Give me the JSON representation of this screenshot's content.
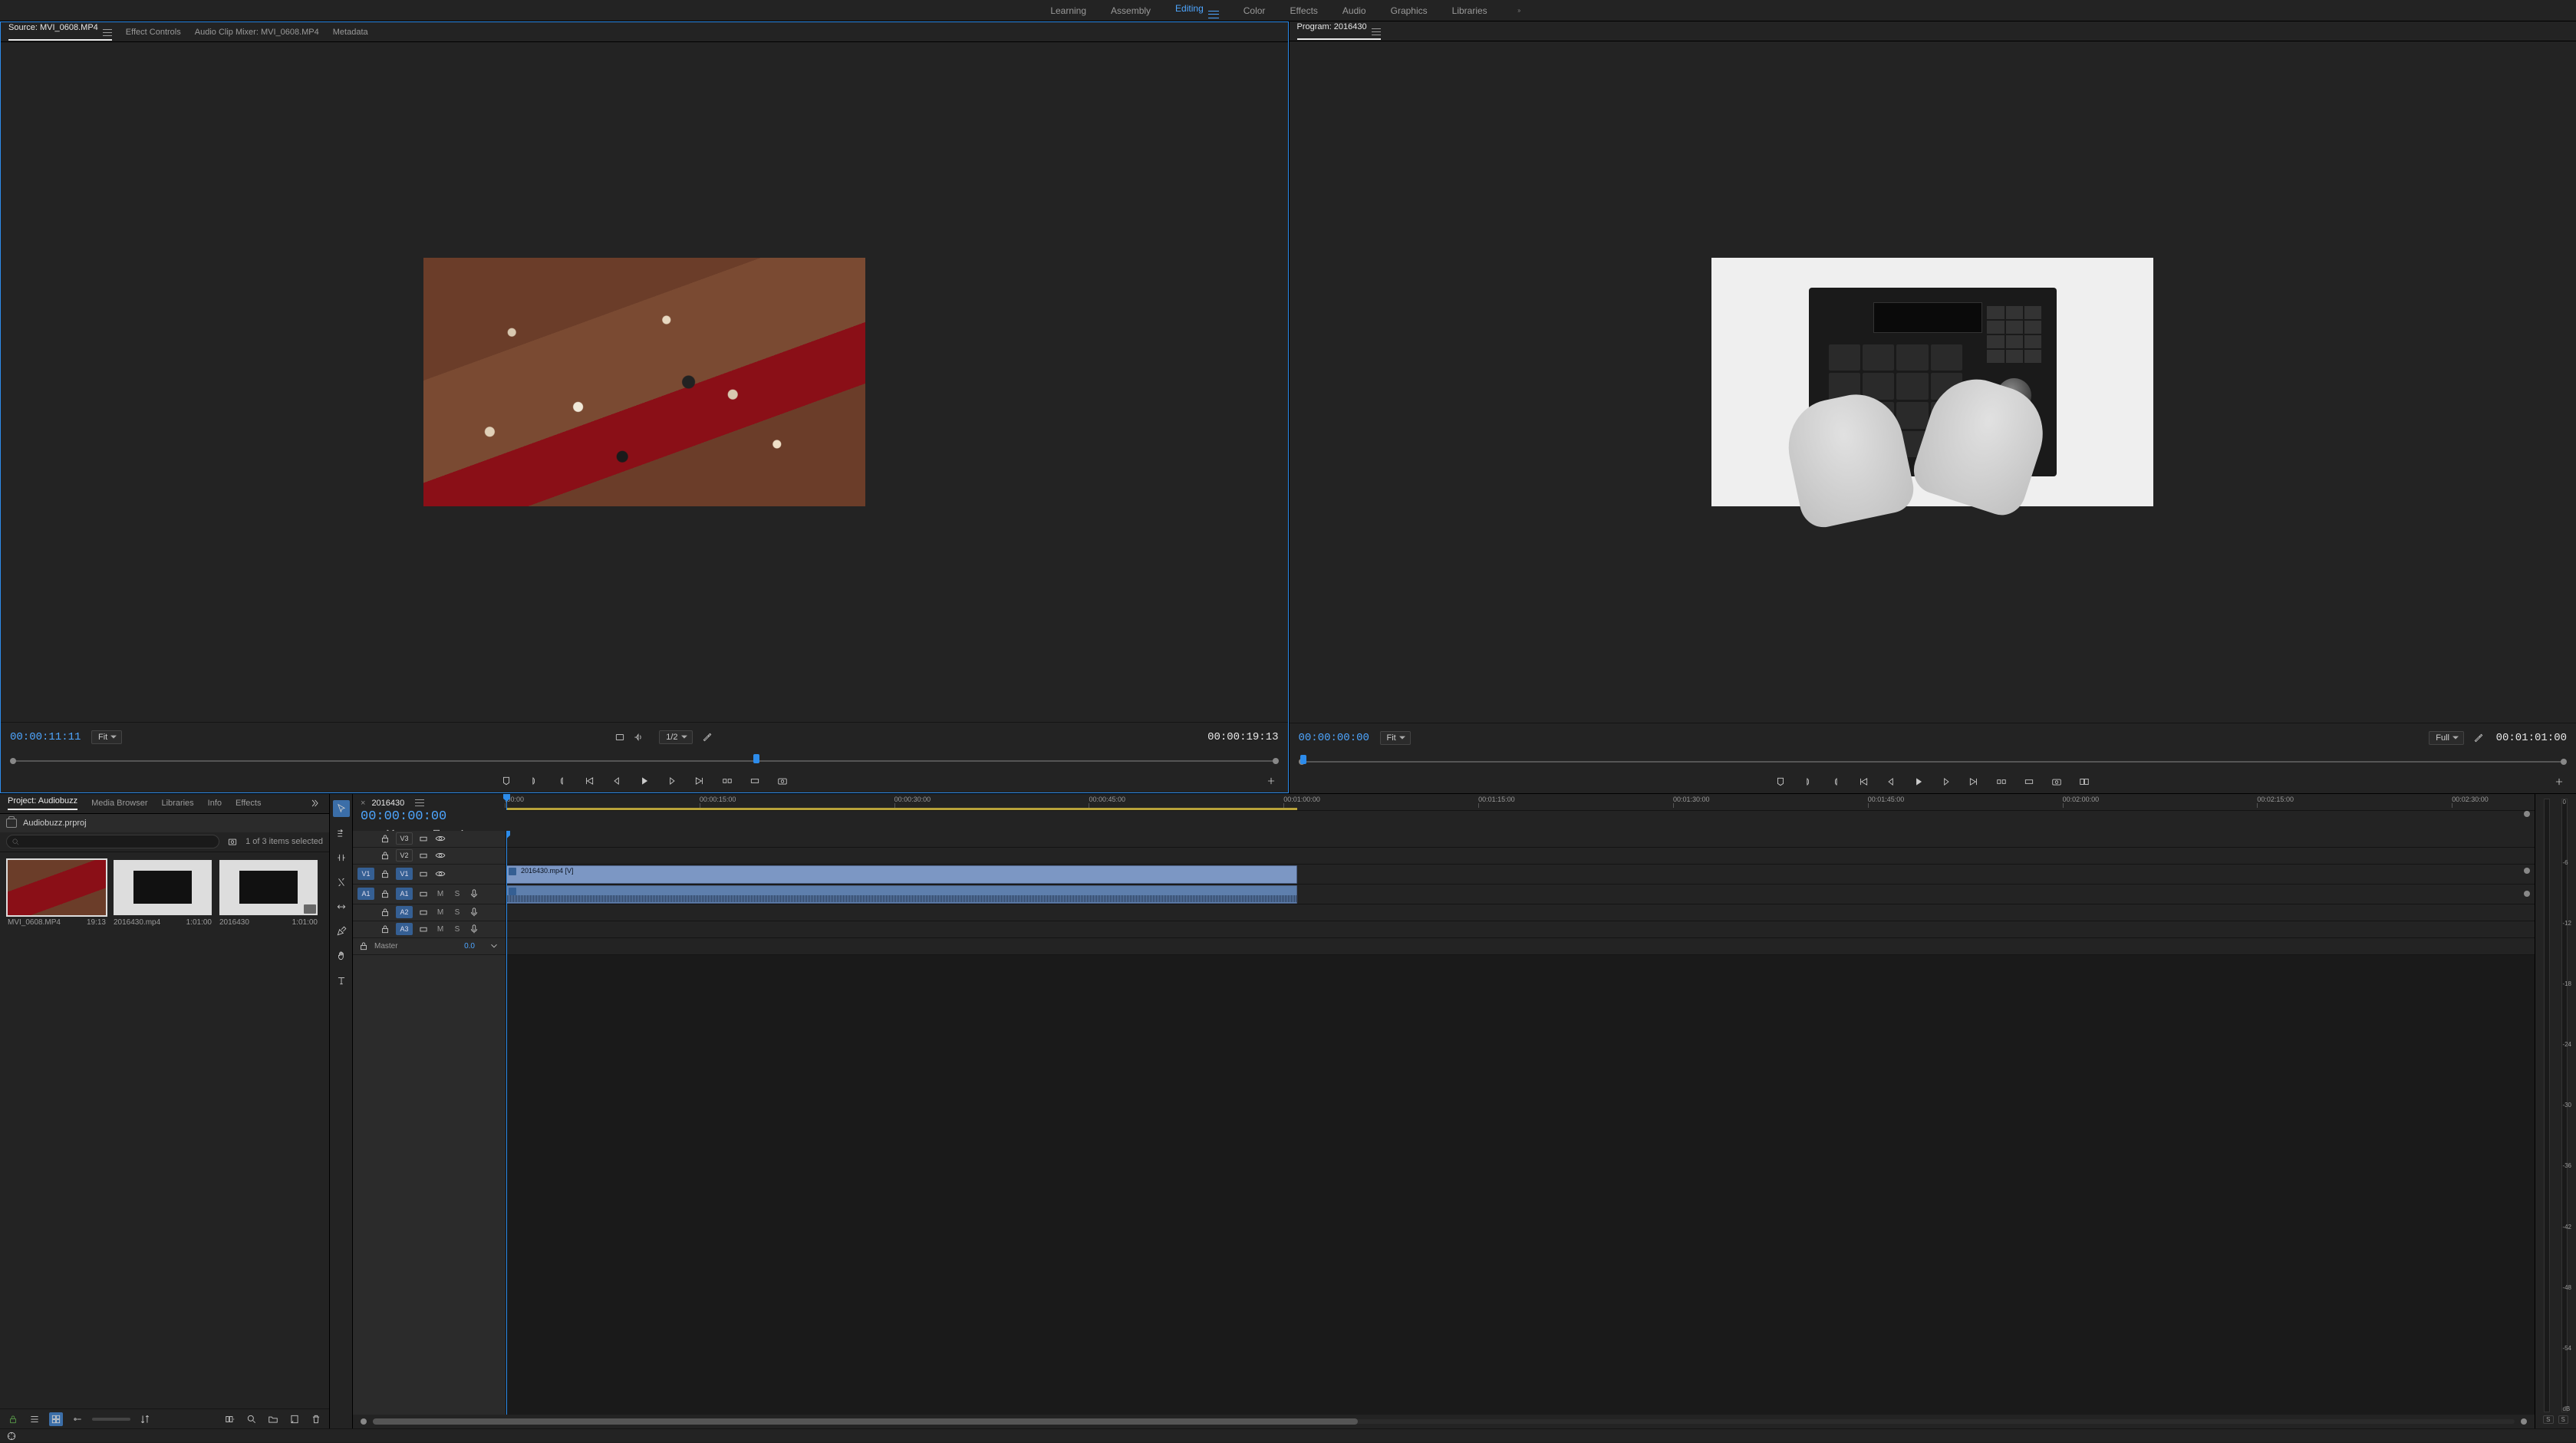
{
  "workspaces": {
    "items": [
      "Learning",
      "Assembly",
      "Editing",
      "Color",
      "Effects",
      "Audio",
      "Graphics",
      "Libraries"
    ],
    "active": "Editing"
  },
  "source_panel": {
    "tabs": [
      {
        "label": "Source: MVI_0608.MP4",
        "active": true
      },
      {
        "label": "Effect Controls"
      },
      {
        "label": "Audio Clip Mixer: MVI_0608.MP4"
      },
      {
        "label": "Metadata"
      }
    ],
    "current_tc": "00:00:11:11",
    "duration_tc": "00:00:19:13",
    "zoom": "Fit",
    "resolution": "1/2"
  },
  "program_panel": {
    "tabs": [
      {
        "label": "Program: 2016430",
        "active": true
      }
    ],
    "current_tc": "00:00:00:00",
    "duration_tc": "00:01:01:00",
    "zoom": "Fit",
    "resolution": "Full"
  },
  "project_panel": {
    "tabs": [
      {
        "label": "Project: Audiobuzz",
        "active": true
      },
      {
        "label": "Media Browser"
      },
      {
        "label": "Libraries"
      },
      {
        "label": "Info"
      },
      {
        "label": "Effects"
      }
    ],
    "project_file": "Audiobuzz.prproj",
    "selection_text": "1 of 3 items selected",
    "items": [
      {
        "name": "MVI_0608.MP4",
        "duration": "19:13",
        "kind": "clip",
        "thumb": "crowd",
        "selected": true
      },
      {
        "name": "2016430.mp4",
        "duration": "1:01:00",
        "kind": "clip",
        "thumb": "mpc"
      },
      {
        "name": "2016430",
        "duration": "1:01:00",
        "kind": "sequence",
        "thumb": "mpc"
      }
    ]
  },
  "timeline": {
    "sequence_name": "2016430",
    "current_tc": "00:00:00:00",
    "ruler_ticks": [
      ";00:00",
      "00:00:15:00",
      "00:00:30:00",
      "00:00:45:00",
      "00:01:00:00",
      "00:01:15:00",
      "00:01:30:00",
      "00:01:45:00",
      "00:02:00:00",
      "00:02:15:00",
      "00:02:30:00"
    ],
    "work_area_pct": 39,
    "tracks_video": [
      {
        "name": "V3"
      },
      {
        "name": "V2"
      },
      {
        "name": "V1",
        "source": "V1",
        "targeted": true
      }
    ],
    "tracks_audio": [
      {
        "name": "A1",
        "source": "A1",
        "targeted": true
      },
      {
        "name": "A2",
        "targeted": true
      },
      {
        "name": "A3",
        "targeted": true
      }
    ],
    "master_label": "Master",
    "master_value": "0.0",
    "clip": {
      "name": "2016430.mp4 [V]",
      "len_pct": 39
    }
  },
  "meters": {
    "labels": [
      "0",
      "-6",
      "-12",
      "-18",
      "-24",
      "-30",
      "-36",
      "-42",
      "-48",
      "-54",
      "dB"
    ],
    "solo": [
      "S",
      "S"
    ]
  },
  "icons": {
    "wrench": "wrench",
    "camera": "camera"
  }
}
